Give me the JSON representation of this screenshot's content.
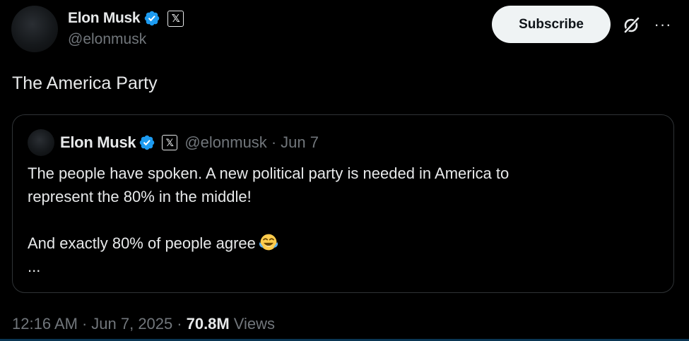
{
  "author": {
    "name": "Elon Musk",
    "handle": "@elonmusk",
    "x_badge": "𝕏"
  },
  "actions": {
    "subscribe_label": "Subscribe",
    "grok_icon": "grok-icon",
    "more_label": "···"
  },
  "tweet": {
    "text": "The America Party"
  },
  "quote": {
    "name": "Elon Musk",
    "x_badge": "𝕏",
    "handle": "@elonmusk",
    "separator": "·",
    "date": "Jun 7",
    "lines": [
      "The people have spoken. A new political party is needed in America to",
      "represent the 80% in the middle!",
      "",
      "And exactly 80% of people agree",
      "..."
    ]
  },
  "meta": {
    "time": "12:16 AM",
    "separator": "·",
    "date": "Jun 7, 2025",
    "separator2": "·",
    "views_count": "70.8M",
    "views_label": "Views"
  },
  "colors": {
    "background": "#000000",
    "text": "#e7e9ea",
    "muted": "#71767b",
    "verified": "#1d9bf0",
    "border": "#2f3336",
    "subscribe_bg": "#eff3f4"
  }
}
